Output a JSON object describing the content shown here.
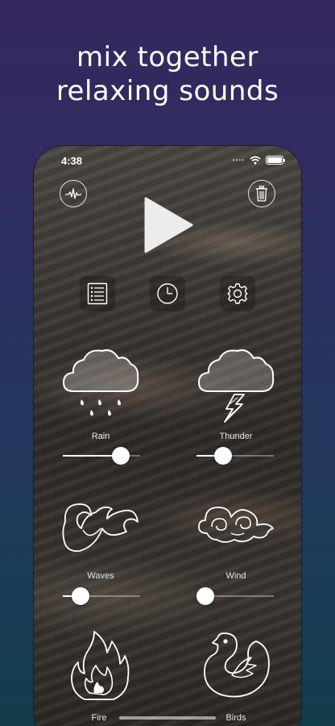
{
  "headline": {
    "line1": "mix together",
    "line2": "relaxing sounds"
  },
  "status_bar": {
    "time": "4:38",
    "battery_level": 1.0
  },
  "toolbar": {
    "visualizer_icon": "waveform-icon",
    "delete_icon": "trash-icon",
    "play_icon": "play-icon",
    "list_icon": "list-icon",
    "timer_icon": "clock-icon",
    "settings_icon": "gear-icon"
  },
  "sounds": [
    {
      "label": "Rain",
      "icon": "rain-cloud-icon",
      "volume": 0.75
    },
    {
      "label": "Thunder",
      "icon": "thunder-cloud-icon",
      "volume": 0.34
    },
    {
      "label": "Waves",
      "icon": "waves-icon",
      "volume": 0.23
    },
    {
      "label": "Wind",
      "icon": "wind-icon",
      "volume": 0.11
    },
    {
      "label": "Fire",
      "icon": "fire-icon"
    },
    {
      "label": "Birds",
      "icon": "bird-icon"
    }
  ]
}
